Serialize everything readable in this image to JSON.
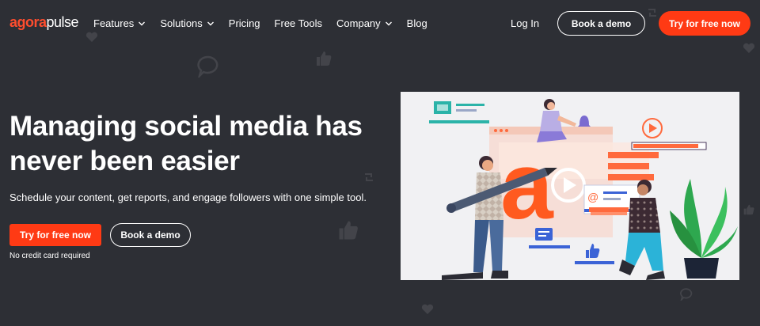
{
  "brand": {
    "logo_part1": "agora",
    "logo_part2": "pulse",
    "accent_color": "#ff3a14",
    "background_color": "#2d2f35"
  },
  "nav": {
    "links": [
      {
        "label": "Features",
        "has_dropdown": true
      },
      {
        "label": "Solutions",
        "has_dropdown": true
      },
      {
        "label": "Pricing",
        "has_dropdown": false
      },
      {
        "label": "Free Tools",
        "has_dropdown": false
      },
      {
        "label": "Company",
        "has_dropdown": true
      },
      {
        "label": "Blog",
        "has_dropdown": false
      }
    ],
    "login_label": "Log In",
    "book_demo_label": "Book a demo",
    "try_free_label": "Try for free now"
  },
  "hero": {
    "title_line1": "Managing social media has",
    "title_line2": "never been easier",
    "subtitle": "Schedule your content, get reports, and engage followers with one simple tool.",
    "primary_cta": "Try for free now",
    "secondary_cta": "Book a demo",
    "note": "No credit card required"
  },
  "illustration": {
    "icons": [
      "play-icon",
      "at-icon",
      "like-icon",
      "chat-icon",
      "bell-icon",
      "plant",
      "person-with-pencil",
      "person-sitting",
      "person-at-laptop"
    ]
  }
}
